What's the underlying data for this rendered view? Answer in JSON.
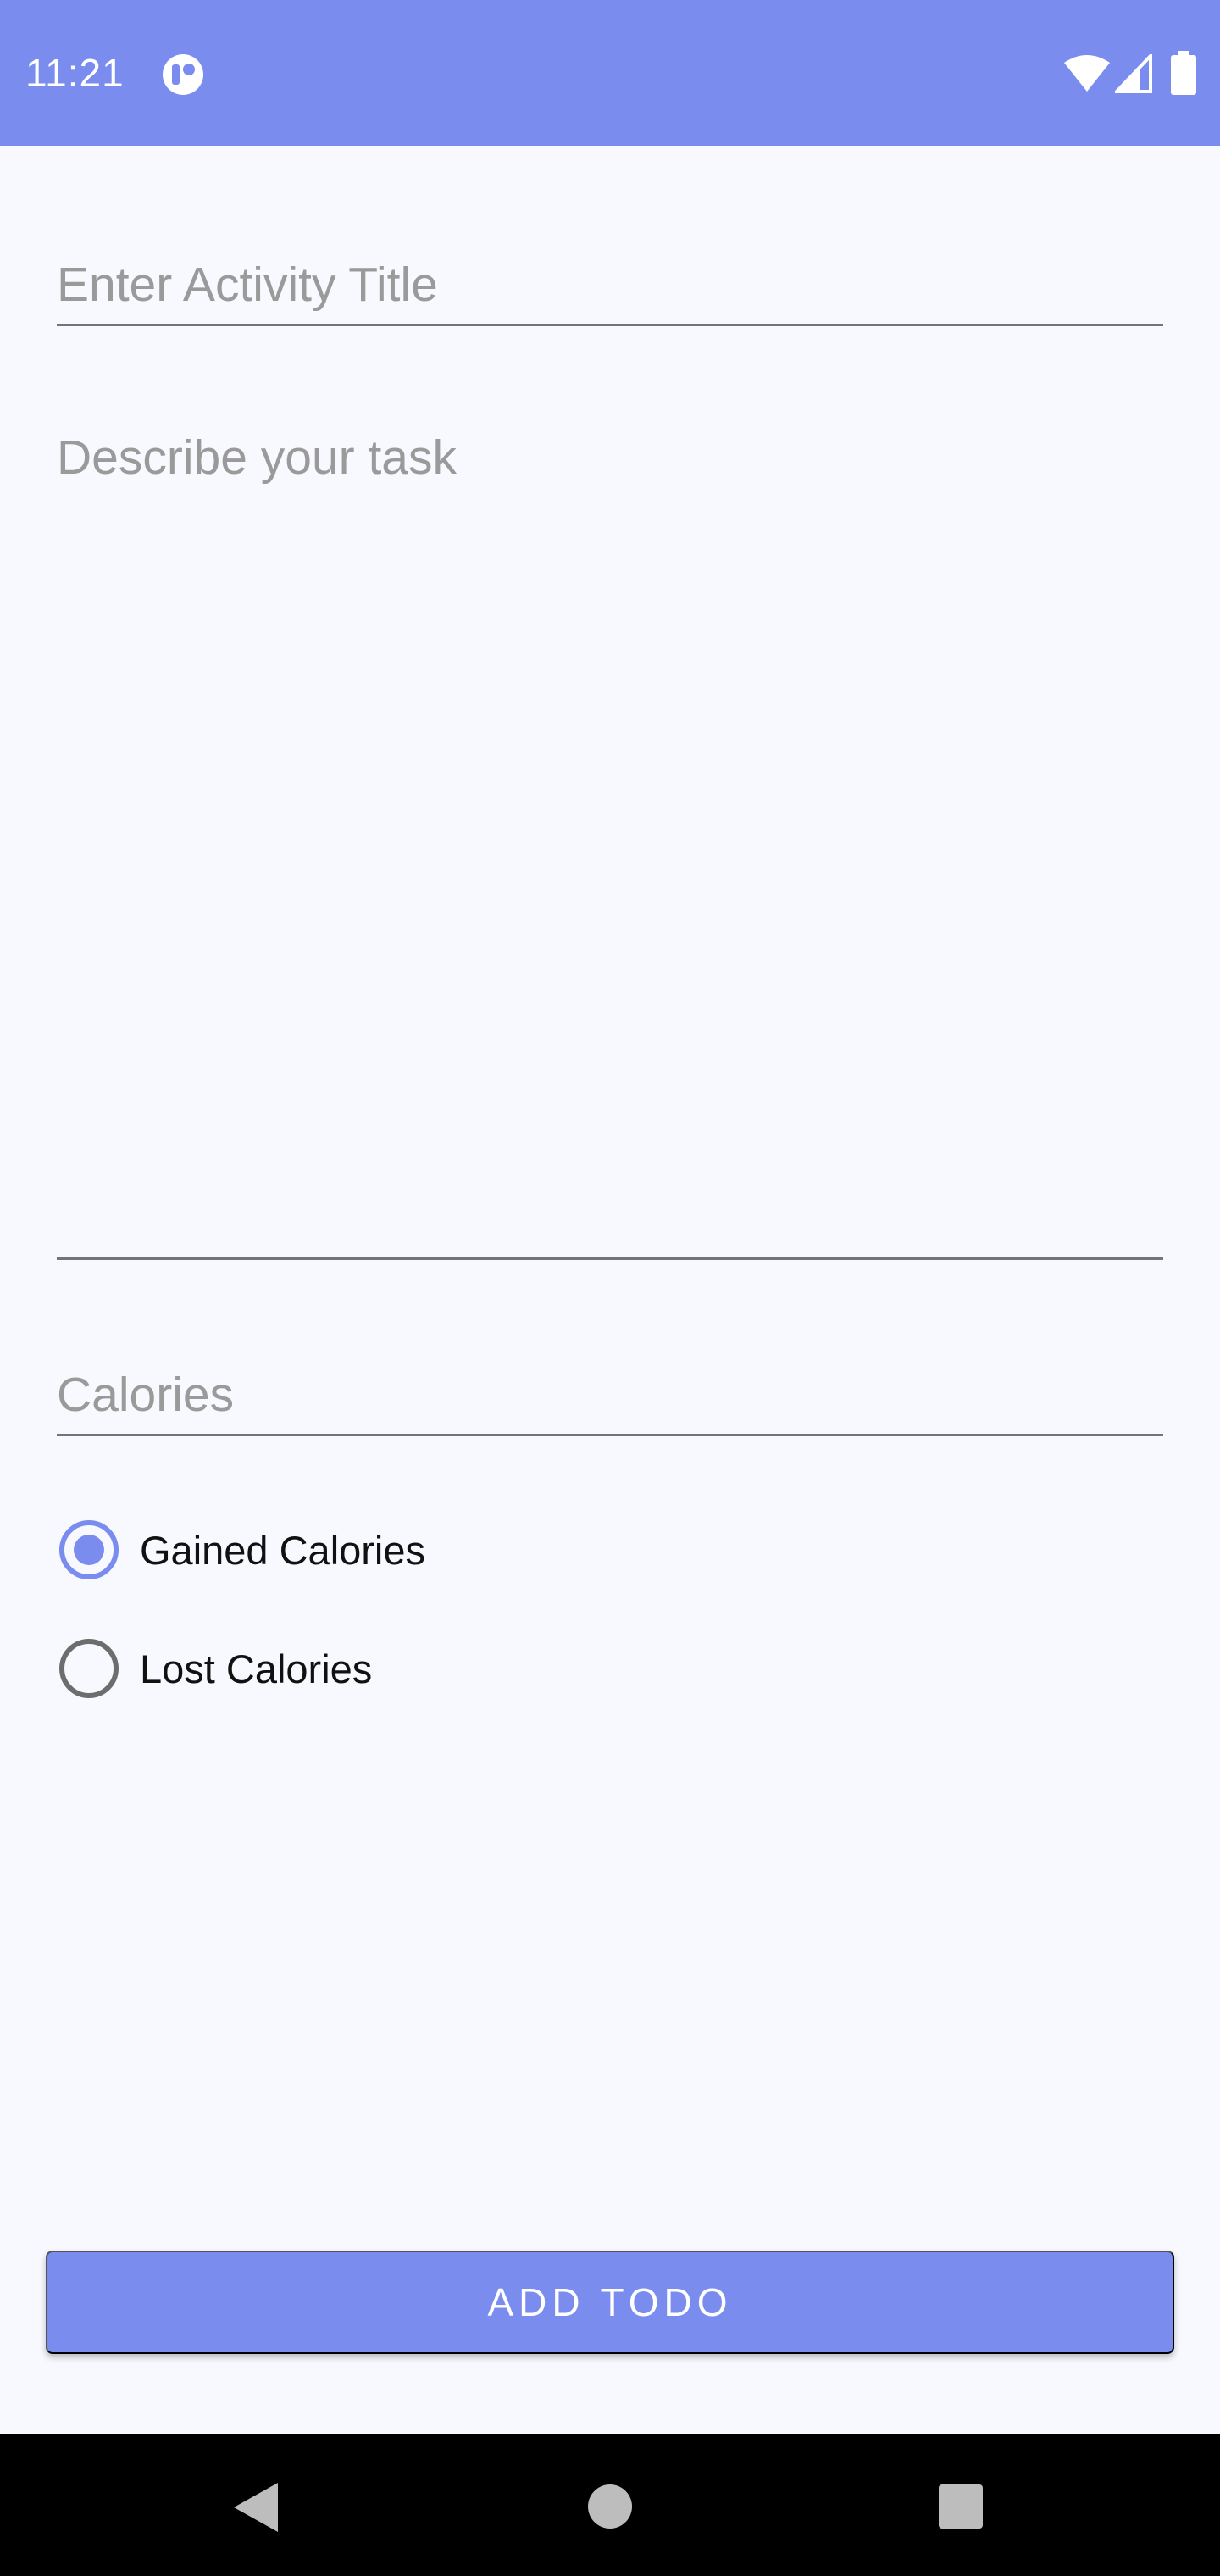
{
  "status_bar": {
    "time": "11:21",
    "background": "#7b8cef",
    "icons": [
      "app-notification-icon",
      "wifi-icon",
      "signal-icon",
      "battery-icon"
    ]
  },
  "form": {
    "title_placeholder": "Enter Activity Title",
    "description_placeholder": "Describe your task",
    "calories_placeholder": "Calories",
    "radio_options": [
      {
        "label": "Gained Calories",
        "checked": true
      },
      {
        "label": "Lost Calories",
        "checked": false
      }
    ]
  },
  "add_button": {
    "label": "ADD TODO",
    "color": "#7b8cef"
  },
  "nav_bar": {
    "icons": [
      "back-icon",
      "home-icon",
      "recents-icon"
    ]
  },
  "colors": {
    "accent": "#7b8cef",
    "background": "#f8f9fe",
    "hint_text": "#9a9a9a"
  }
}
